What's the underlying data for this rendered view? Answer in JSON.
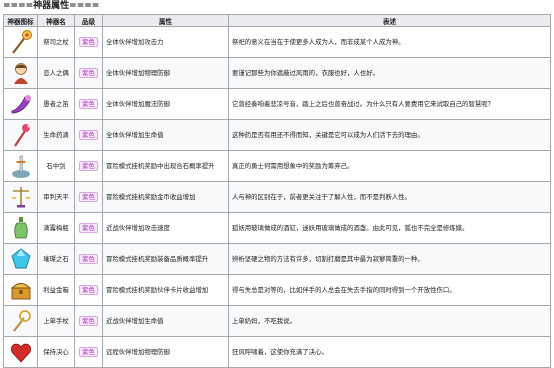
{
  "heading": "====神器属性====",
  "columns": [
    "神器图标",
    "神器名",
    "品级",
    "属性",
    "表述"
  ],
  "rows": [
    {
      "icon": "staff-icon",
      "name": "祭司之杖",
      "grade": "紫色",
      "attr": "全体伙伴增加攻击力",
      "lore": "祭祀的意义在当在于使更多人成为人，而非成某个人成为神。"
    },
    {
      "icon": "doll-icon",
      "name": "恋人之偶",
      "grade": "紫色",
      "attr": "全体伙伴增加物理防御",
      "lore": "要谨记那些为你遮蔽过风雨的，衣服也好，人也好。"
    },
    {
      "icon": "horn-icon",
      "name": "愚者之笛",
      "grade": "紫色",
      "attr": "全体伙伴增加魔法防御",
      "lore": "它曾经奏响着悲凉号音，踏上之后也曾奋战过。为什么只有人要费用它来试取自己的智慧呢？"
    },
    {
      "icon": "bone-staff-icon",
      "name": "生命药滴",
      "grade": "紫色",
      "attr": "全体伙伴增加生命值",
      "lore": "这种药是否有用还不得而知，关键是它可以成为人们活下去的理由。"
    },
    {
      "icon": "sword-in-stone-icon",
      "name": "石中剑",
      "grade": "紫色",
      "attr": "冒险模式挂机奖励中出现合石概率提升",
      "lore": "真正的勇士何需用想象中的奖励为筹弃己。"
    },
    {
      "icon": "scales-icon",
      "name": "审判天平",
      "grade": "紫色",
      "attr": "冒险模式挂机奖励金币收益增加",
      "lore": "人与神的区别在于，前者更关注于了解人性，而不是判断人性。"
    },
    {
      "icon": "bottle-icon",
      "name": "滴露梅瓶",
      "grade": "紫色",
      "attr": "近战伙伴增加攻击速度",
      "lore": "狐妖用玻璃做成的酒缸，迷妖用玻璃做成的酒盏。由此可见，狐也不完全是修炼媒。"
    },
    {
      "icon": "gem-icon",
      "name": "璀璨之石",
      "grade": "紫色",
      "attr": "冒险模式挂机奖励装备品质概率提升",
      "lore": "辨析坚硬之物的方法有许多，切割打磨是其中最为寂寥简重的一种。"
    },
    {
      "icon": "chest-icon",
      "name": "利益金箱",
      "grade": "紫色",
      "attr": "冒险模式挂机奖励伙伴卡片收益增加",
      "lore": "得与失总是对等的，比如伴手的人总会在失去手指的同时得到一个开放性伤口。"
    },
    {
      "icon": "wand-icon",
      "name": "上单手杖",
      "grade": "紫色",
      "attr": "近战伙伴增加生命值",
      "lore": "上单奶妈，不吃我说。"
    },
    {
      "icon": "heart-icon",
      "name": "保持决心",
      "grade": "紫色",
      "attr": "远程伙伴增加物理防御",
      "lore": "狂风呼啸着，这使你充满了决心。"
    }
  ]
}
